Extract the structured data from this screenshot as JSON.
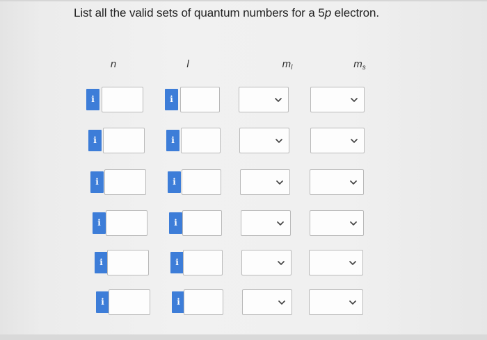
{
  "question": {
    "prefix": "List all the valid sets of quantum numbers for a 5",
    "orbital_letter": "p",
    "suffix": " electron."
  },
  "columns": {
    "n": {
      "label": "n",
      "sub": ""
    },
    "l": {
      "label": "l",
      "sub": ""
    },
    "ml": {
      "label": "m",
      "sub": "l"
    },
    "ms": {
      "label": "m",
      "sub": "s"
    }
  },
  "info_icon_glyph": "i",
  "info_icon_name": "info-icon",
  "dropdown_icon_name": "chevron-down-icon",
  "accent_color": "#3d7dd8",
  "rows": [
    {
      "n": "",
      "l": "",
      "ml": "",
      "ms": ""
    },
    {
      "n": "",
      "l": "",
      "ml": "",
      "ms": ""
    },
    {
      "n": "",
      "l": "",
      "ml": "",
      "ms": ""
    },
    {
      "n": "",
      "l": "",
      "ml": "",
      "ms": ""
    },
    {
      "n": "",
      "l": "",
      "ml": "",
      "ms": ""
    },
    {
      "n": "",
      "l": "",
      "ml": "",
      "ms": ""
    }
  ]
}
